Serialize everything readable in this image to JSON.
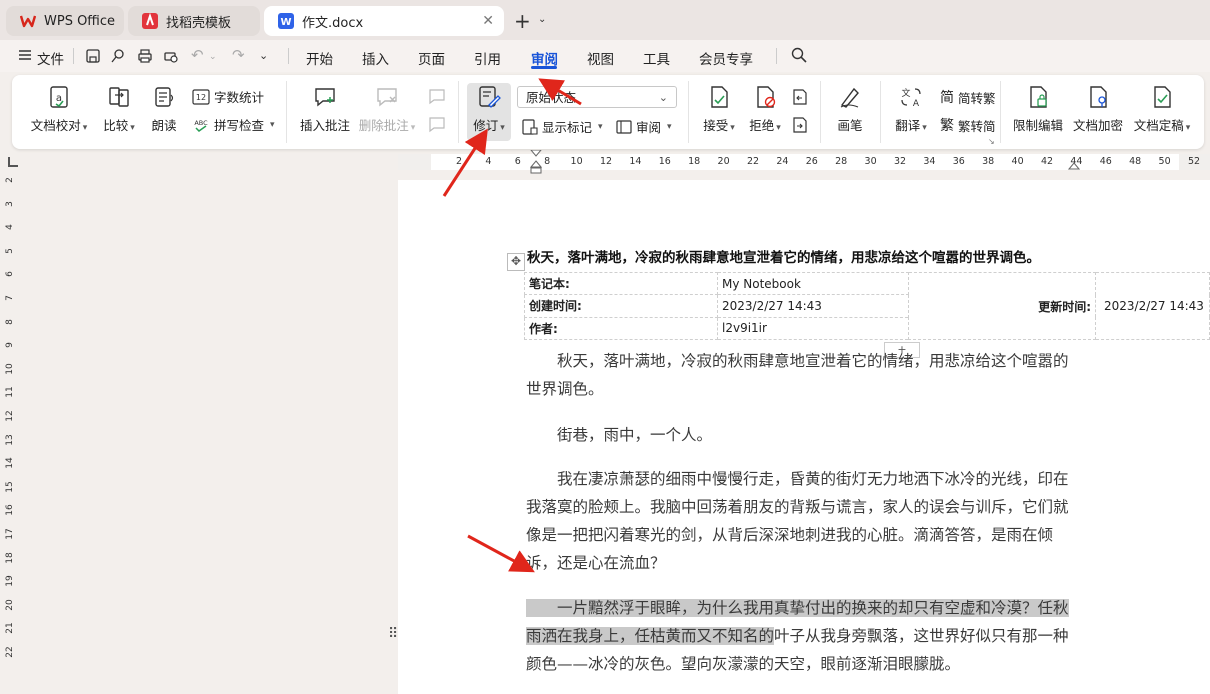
{
  "tabs": [
    {
      "label": "WPS Office",
      "icon": "wps-logo-icon"
    },
    {
      "label": "找稻壳模板",
      "icon": "docer-icon"
    },
    {
      "label": "作文.docx",
      "icon": "word-doc-icon"
    }
  ],
  "menu": {
    "file": "文件",
    "items": [
      "开始",
      "插入",
      "页面",
      "引用",
      "审阅",
      "视图",
      "工具",
      "会员专享"
    ],
    "active": "审阅"
  },
  "ribbon": {
    "proofread": "文档校对",
    "compare": "比较",
    "read_aloud": "朗读",
    "word_count": "字数统计",
    "spell_check": "拼写检查",
    "insert_comment": "插入批注",
    "delete_comment": "删除批注",
    "track_changes": "修订",
    "status_select": "原始状态",
    "show_markup": "显示标记",
    "review_pane": "审阅",
    "accept": "接受",
    "reject": "拒绝",
    "pen": "画笔",
    "translate": "翻译",
    "to_traditional": "简转繁",
    "to_simplified": "繁转简",
    "restrict_edit": "限制编辑",
    "encrypt": "文档加密",
    "finalize": "文档定稿"
  },
  "ruler": {
    "h_ticks": [
      "2",
      "4",
      "6",
      "8",
      "10",
      "12",
      "14",
      "16",
      "18",
      "20",
      "22",
      "24",
      "26",
      "28",
      "30",
      "32",
      "34",
      "36",
      "38",
      "40",
      "42",
      "44",
      "46",
      "48",
      "50",
      "52"
    ],
    "v_ticks": [
      "2",
      "3",
      "4",
      "5",
      "6",
      "7",
      "8",
      "9",
      "10",
      "11",
      "12",
      "13",
      "14",
      "15",
      "16",
      "17",
      "18",
      "19",
      "20",
      "21",
      "22"
    ]
  },
  "document": {
    "title": "秋天，落叶满地，冷寂的秋雨肆意地宣泄着它的情绪，用悲凉给这个喧嚣的世界调色。",
    "meta": {
      "notebook_label": "笔记本:",
      "notebook_value": "My Notebook",
      "created_label": "创建时间:",
      "created_value": "2023/2/27 14:43",
      "author_label": "作者:",
      "author_value": "l2v9i1ir",
      "updated_label": "更新时间:",
      "updated_value": "2023/2/27 14:43"
    },
    "p1": "　　秋天，落叶满地，冷寂的秋雨肆意地宣泄着它的情绪，用悲凉给这个喧嚣的世界调色。",
    "p2": "　　街巷，雨中，一个人。",
    "p3": "　　我在凄凉萧瑟的细雨中慢慢行走，昏黄的街灯无力地洒下冰冷的光线，印在我落寞的脸颊上。我脑中回荡着朋友的背叛与谎言，家人的误会与训斥，它们就像是一把把闪着寒光的剑，从背后深深地刺进我的心脏。滴滴答答，是雨在倾诉，还是心在流血？",
    "p4_selected": "　　一片黯然浮于眼眸，为什么我用真挚付出的换来的却只有空虚和冷漠？任秋雨洒在我身上，任枯黄而又不知名的",
    "p4_rest": "叶子从我身旁飘落，这世界好似只有那一种颜色——冰冷的灰色。望向灰濛濛的天空，眼前逐渐泪眼朦胧。"
  },
  "colors": {
    "accent": "#1a55d8",
    "arrow": "#e0261b",
    "selection": "#c9c9c9"
  }
}
